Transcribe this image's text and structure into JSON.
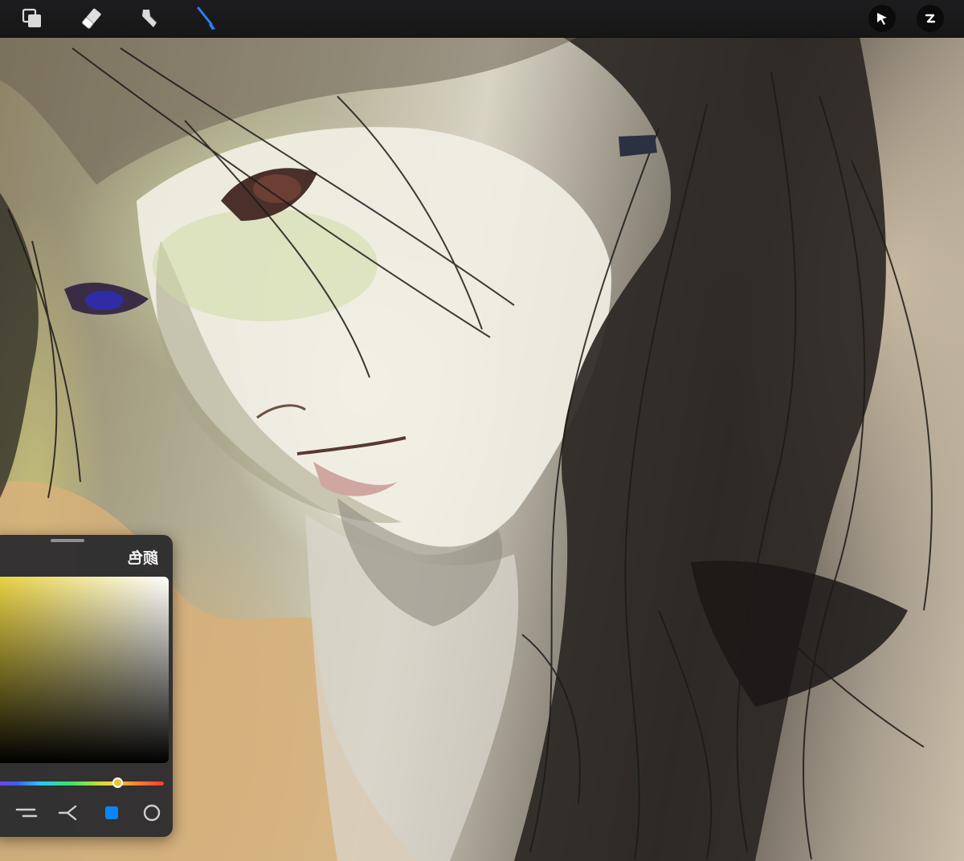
{
  "toolbar": {
    "left_tools": [
      {
        "name": "layers",
        "icon": "layers-icon"
      },
      {
        "name": "eraser",
        "icon": "eraser-icon"
      },
      {
        "name": "smudge",
        "icon": "smudge-icon"
      },
      {
        "name": "brush",
        "icon": "brush-icon",
        "active": true,
        "active_color": "#2f7df6"
      }
    ],
    "right_tools": [
      {
        "name": "select",
        "icon": "cursor-arrow-icon"
      },
      {
        "name": "history",
        "icon": "undo-icon"
      }
    ]
  },
  "canvas": {
    "description_icon": "artwork-canvas"
  },
  "color_panel": {
    "title": "颜色",
    "current_color": "#e6c634",
    "accent": "#0a84ff",
    "modes": [
      {
        "name": "palette",
        "icon": "sliders-icon"
      },
      {
        "name": "harmony",
        "icon": "harmony-icon"
      },
      {
        "name": "swatches",
        "icon": "swatch-square-icon",
        "active": true
      },
      {
        "name": "disc",
        "icon": "circle-icon"
      }
    ]
  }
}
